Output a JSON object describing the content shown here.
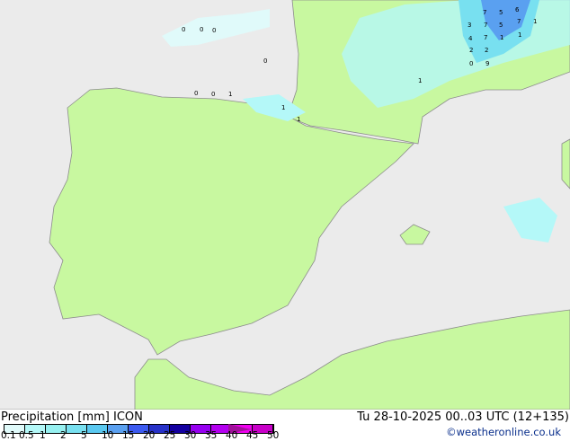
{
  "map": {
    "sea_color": "#ebebeb",
    "land_color": "#c8f8a0",
    "border_color": "#8c8c8c",
    "precip_values": [
      {
        "v": "0"
      },
      {
        "v": "0"
      },
      {
        "v": "0"
      },
      {
        "v": "0"
      },
      {
        "v": "0"
      },
      {
        "v": "1"
      },
      {
        "v": "0"
      },
      {
        "v": "1"
      },
      {
        "v": "1"
      },
      {
        "v": "7"
      },
      {
        "v": "5"
      },
      {
        "v": "6"
      },
      {
        "v": "7"
      },
      {
        "v": "1"
      },
      {
        "v": "7"
      },
      {
        "v": "5"
      },
      {
        "v": "3"
      },
      {
        "v": "1"
      },
      {
        "v": "4"
      },
      {
        "v": "7"
      },
      {
        "v": "2"
      },
      {
        "v": "1"
      },
      {
        "v": "2"
      },
      {
        "v": "0"
      },
      {
        "v": "9"
      },
      {
        "v": "1"
      }
    ]
  },
  "footer": {
    "title": "Precipitation [mm] ICON",
    "datetime": "Tu 28-10-2025 00..03 UTC (12+135)",
    "credit": "©weatheronline.co.uk",
    "legend_ticks": [
      "0.1",
      "0.5",
      "1",
      "2",
      "5",
      "10",
      "15",
      "20",
      "25",
      "30",
      "35",
      "40",
      "45",
      "50"
    ],
    "legend_colors": [
      "#e0fafa",
      "#b4f8f8",
      "#96f0f0",
      "#78e0f0",
      "#5ac8f0",
      "#5aa0f0",
      "#3c5af0",
      "#2832c8",
      "#1400a0",
      "#9600f0",
      "#b400f0",
      "#f000f0",
      "#c800c8"
    ]
  }
}
